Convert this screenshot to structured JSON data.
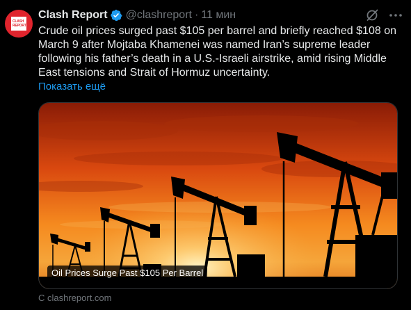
{
  "author": {
    "name": "Clash Report",
    "handle": "@clashreport",
    "separator": "·",
    "time": "11 мин",
    "avatar_text": [
      "CLASH",
      "REPORT"
    ],
    "verified": true
  },
  "icons": {
    "verified": "verified-badge-icon",
    "grok": "grok-icon",
    "more": "more-horizontal-icon"
  },
  "tweet": {
    "text": "Crude oil prices surged past $105 per barrel and briefly reached $108 on March 9 after Mojtaba Khamenei was named Iran’s supreme leader following his father’s death in a U.S.-Israeli airstrike, amid rising Middle East tensions and Strait of Hormuz uncertainty.",
    "show_more": "Показать ещё"
  },
  "card": {
    "caption": "Oil Prices Surge Past $105 Per Barrel",
    "source": "С clashreport.com"
  },
  "colors": {
    "background": "#000000",
    "text": "#e7e9ea",
    "muted": "#71767b",
    "link": "#1d9bf0",
    "verified": "#1d9bf0",
    "avatar": "#e0242d"
  }
}
